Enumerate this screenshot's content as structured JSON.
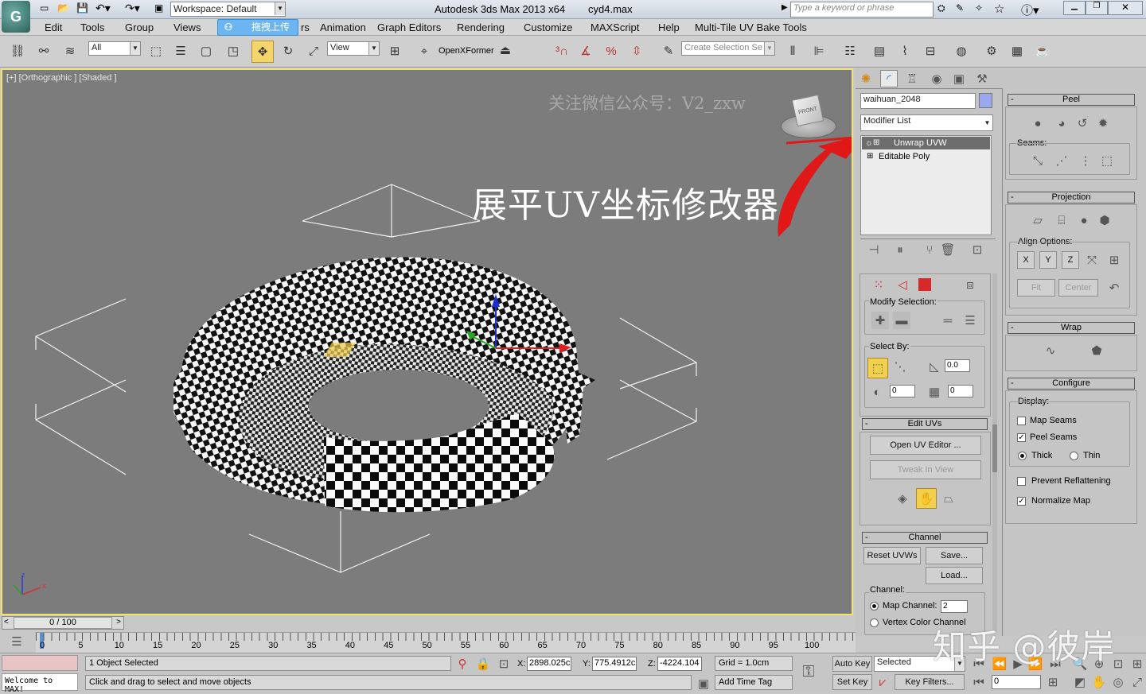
{
  "window": {
    "title": "Autodesk 3ds Max  2013 x64",
    "filename": "cyd4.max",
    "workspace": "Workspace: Default",
    "search_placeholder": "Type a keyword or phrase"
  },
  "menu": {
    "items": [
      "Edit",
      "Tools",
      "Group",
      "Views",
      "rs",
      "Animation",
      "Graph Editors",
      "Rendering",
      "Customize",
      "MAXScript",
      "Help",
      "Multi-Tile UV Bake Tools"
    ],
    "upload_badge": "拖拽上传"
  },
  "toolbar": {
    "filter_value": "All",
    "ref_coord": "View",
    "openxformer_label": "OpenXFormer",
    "selection_set_placeholder": "Create Selection Se"
  },
  "viewport": {
    "label": "[+] [Orthographic ] [Shaded ]",
    "watermark": "关注微信公众号：V2_zxw",
    "annotation": "展平UV坐标修改器",
    "viewcube_face": "FRONT",
    "axis_z": "z",
    "axis_x": "x"
  },
  "modifier_panel": {
    "object_name": "waihuan_2048",
    "object_color": "#9aa8f0",
    "modifier_list": "Modifier List",
    "stack": [
      "Unwrap UVW",
      "Editable Poly"
    ]
  },
  "unwrap": {
    "modify_selection_label": "Modify Selection:",
    "select_by_label": "Select By:",
    "angle_value": "0.0",
    "spin_a": "0",
    "spin_b": "0",
    "edit_uvs_header": "Edit UVs",
    "open_uv_editor": "Open UV Editor ...",
    "tweak_in_view": "Tweak In View",
    "channel_header": "Channel",
    "reset_uvws": "Reset UVWs",
    "save": "Save...",
    "load": "Load...",
    "channel_label": "Channel:",
    "map_channel_label": "Map Channel:",
    "map_channel_value": "2",
    "vertex_color_channel": "Vertex Color Channel"
  },
  "right_panel": {
    "peel_header": "Peel",
    "seams_label": "Seams:",
    "projection_header": "Projection",
    "align_label": "Align Options:",
    "align_x": "X",
    "align_y": "Y",
    "align_z": "Z",
    "fit": "Fit",
    "center": "Center",
    "wrap_header": "Wrap",
    "configure_header": "Configure",
    "display_label": "Display:",
    "map_seams": "Map Seams",
    "peel_seams": "Peel Seams",
    "thick": "Thick",
    "thin": "Thin",
    "prevent_reflattening": "Prevent Reflattening",
    "normalize_map": "Normalize Map",
    "checks": {
      "map_seams": false,
      "peel_seams": true,
      "prevent_reflattening": false,
      "normalize_map": true
    }
  },
  "timeline": {
    "frame_display": "0 / 100",
    "ticks": [
      "0",
      "5",
      "10",
      "15",
      "20",
      "25",
      "30",
      "35",
      "40",
      "45",
      "50",
      "55",
      "60",
      "65",
      "70",
      "75",
      "80",
      "85",
      "90",
      "95",
      "100"
    ]
  },
  "status": {
    "maxscript": "Welcome to MAX!",
    "selection": "1 Object Selected",
    "prompt": "Click and drag to select and move objects",
    "x_label": "X:",
    "x": "2898.025c",
    "y_label": "Y:",
    "y": "775.4912c",
    "z_label": "Z:",
    "z": "-4224.104",
    "grid": "Grid = 1.0cm",
    "add_time_tag": "Add Time Tag",
    "auto_key": "Auto Key",
    "set_key": "Set Key",
    "selected": "Selected",
    "key_filters": "Key Filters...",
    "frame": "0"
  },
  "zhihu_watermark": "知乎 @彼岸"
}
